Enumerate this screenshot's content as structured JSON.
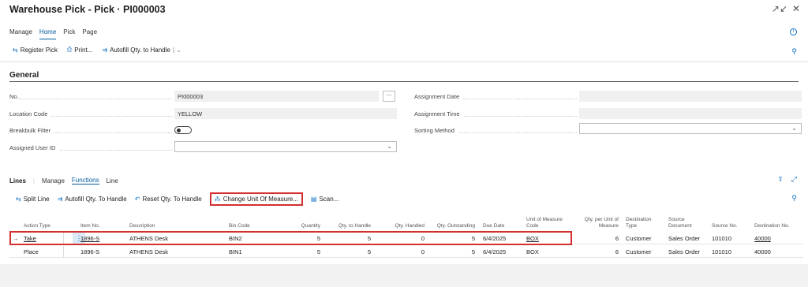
{
  "window": {
    "title": "Warehouse Pick - Pick · PI000003",
    "collapse_icon": "↗↙",
    "close_icon": "✕"
  },
  "action_tabs": [
    "Manage",
    "Home",
    "Pick",
    "Page"
  ],
  "home_actions": {
    "register_pick": "Register Pick",
    "print": "Print...",
    "autofill": "Autofill Qty. to Handle"
  },
  "general": {
    "title": "General",
    "no_label": "No.",
    "no_value": "PI000003",
    "location_label": "Location Code",
    "location_value": "YELLOW",
    "breakbulk_label": "Breakbulk Filter",
    "assigned_user_label": "Assigned User ID",
    "assigned_user_value": "",
    "assignment_date_label": "Assignment Date",
    "assignment_date_value": "",
    "assignment_time_label": "Assignment Time",
    "assignment_time_value": "",
    "sorting_label": "Sorting Method",
    "sorting_value": ""
  },
  "lines": {
    "title": "Lines",
    "tabs": [
      "Manage",
      "Functions",
      "Line"
    ],
    "actions": {
      "split": "Split Line",
      "autofill": "Autofill Qty. To Handle",
      "reset": "Reset Qty. To Handle",
      "change_uom": "Change Unit Of Measure...",
      "scan": "Scan..."
    },
    "columns": {
      "action_type": "Action Type",
      "item_no": "Item No.",
      "description": "Description",
      "bin_code": "Bin Code",
      "quantity": "Quantity",
      "qty_to_handle": "Qty. to Handle",
      "qty_handled": "Qty. Handled",
      "qty_outstanding": "Qty. Outstanding",
      "due_date": "Due Date",
      "uom_code_1": "Unit of Measure",
      "uom_code_2": "Code",
      "qty_per_uom_1": "Qty. per Unit of",
      "qty_per_uom_2": "Measure",
      "dest_type_1": "Destination",
      "dest_type_2": "Type",
      "source_doc_1": "Source",
      "source_doc_2": "Document",
      "source_no": "Source No.",
      "dest_no": "Destination No."
    },
    "rows": [
      {
        "arrow": "→",
        "action_type": "Take",
        "item_no": "1896-S",
        "description": "ATHENS Desk",
        "bin_code": "BIN2",
        "quantity": "5",
        "qty_to_handle": "5",
        "qty_handled": "0",
        "qty_outstanding": "5",
        "due_date": "6/4/2025",
        "uom": "BOX",
        "qty_per_uom": "6",
        "dest_type": "Customer",
        "source_doc": "Sales Order",
        "source_no": "101010",
        "dest_no": "40000"
      },
      {
        "arrow": "",
        "action_type": "Place",
        "item_no": "1896-S",
        "description": "ATHENS Desk",
        "bin_code": "BIN1",
        "quantity": "5",
        "qty_to_handle": "5",
        "qty_handled": "0",
        "qty_outstanding": "5",
        "due_date": "6/4/2025",
        "uom": "BOX",
        "qty_per_uom": "6",
        "dest_type": "Customer",
        "source_doc": "Sales Order",
        "source_no": "101010",
        "dest_no": "40000"
      }
    ]
  },
  "colors": {
    "accent": "#005a9e",
    "highlight": "#d32f2f"
  }
}
